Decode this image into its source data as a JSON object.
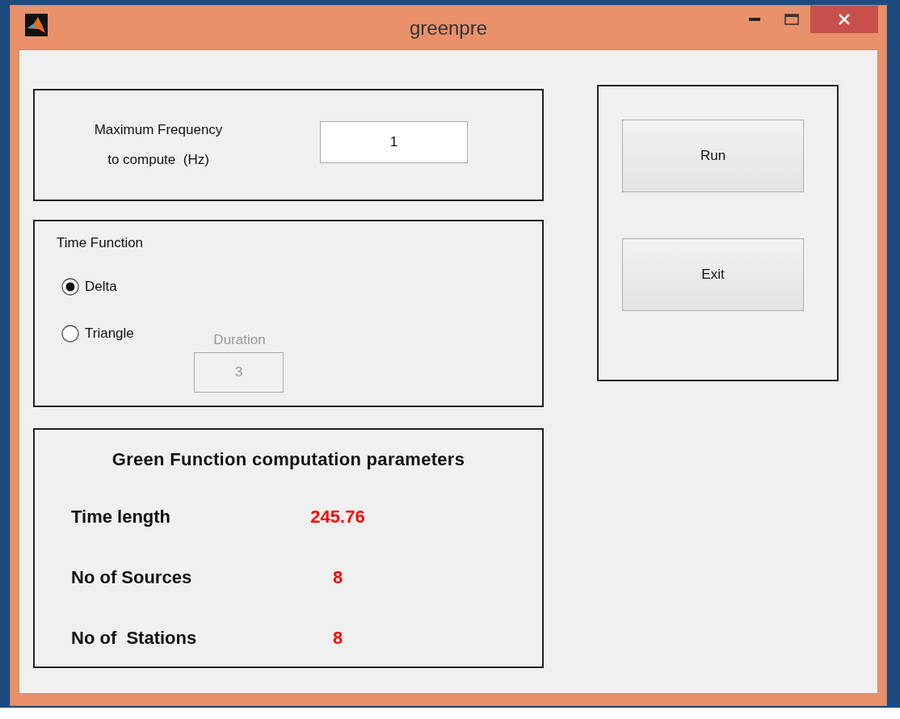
{
  "window": {
    "title": "greenpre"
  },
  "frequency": {
    "label_lines": [
      "Maximum Frequency",
      "to compute  (Hz)"
    ],
    "value": "1"
  },
  "time_function": {
    "title": "Time Function",
    "options": [
      {
        "label": "Delta",
        "selected": true
      },
      {
        "label": "Triangle",
        "selected": false
      }
    ],
    "duration": {
      "label": "Duration",
      "value": "3",
      "disabled": true
    }
  },
  "parameters": {
    "title": "Green Function computation parameters",
    "rows": [
      {
        "label": "Time length",
        "value": "245.76"
      },
      {
        "label": "No of Sources",
        "value": "8"
      },
      {
        "label": "No of  Stations",
        "value": "8"
      }
    ]
  },
  "buttons": [
    "Run",
    "Exit"
  ]
}
